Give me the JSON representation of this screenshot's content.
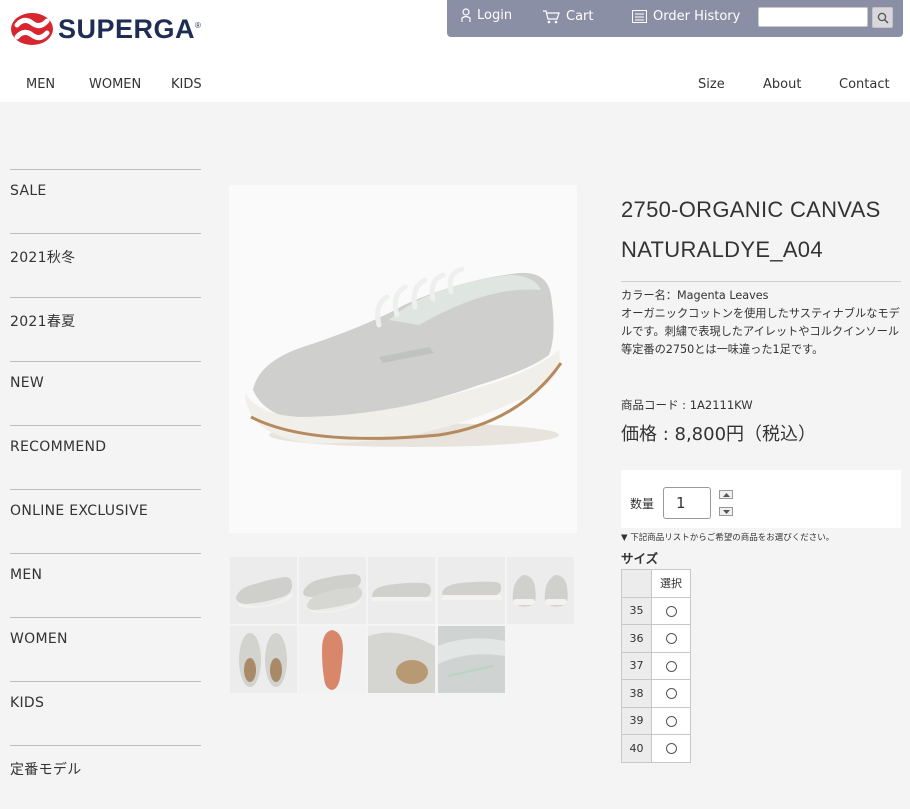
{
  "brand": {
    "name": "SUPERGA",
    "registered": "®"
  },
  "topbar": {
    "login": "Login",
    "cart": "Cart",
    "order_history": "Order History",
    "search_placeholder": ""
  },
  "nav": {
    "left": [
      "MEN",
      "WOMEN",
      "KIDS"
    ],
    "right": [
      "Size",
      "About",
      "Contact"
    ]
  },
  "sidebar": {
    "items": [
      "SALE",
      "2021秋冬",
      "2021春夏",
      "NEW",
      "RECOMMEND",
      "ONLINE EXCLUSIVE",
      "MEN",
      "WOMEN",
      "KIDS",
      "定番モデル"
    ]
  },
  "product": {
    "title_line1": "2750-ORGANIC CANVAS",
    "title_line2": "NATURALDYE_A04",
    "color_label": "カラー名：",
    "color_value": "Magenta Leaves",
    "description": "オーガニックコットンを使用したサスティナブルなモデルです。刺繍で表現したアイレットやコルクインソール等定番の2750とは一味違った1足です。",
    "code_label": "商品コード : ",
    "code_value": "1A2111KW",
    "price": "価格 : 8,800円（税込）",
    "quantity_label": "数量",
    "quantity_value": "1",
    "note": "▼ 下記商品リストからご希望の商品をお選びください。",
    "size_heading": "サイズ",
    "size_column": "選択",
    "sizes": [
      "35",
      "36",
      "37",
      "38",
      "39",
      "40"
    ]
  },
  "colors": {
    "topbar_bg": "#8a8fa6",
    "logo_red": "#d7262f",
    "logo_navy": "#1f2d55",
    "page_bg": "#f4f4f4"
  }
}
